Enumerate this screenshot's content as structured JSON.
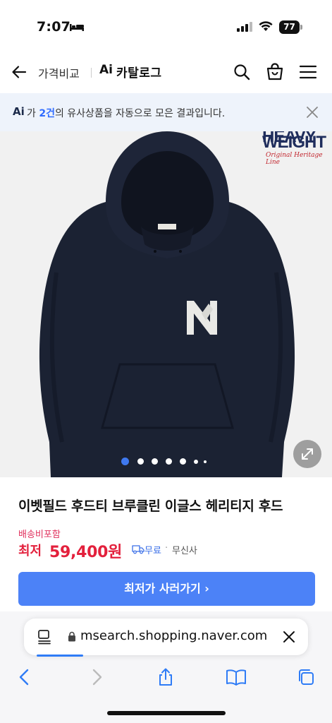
{
  "status_bar": {
    "time": "7:07",
    "battery": "77"
  },
  "header": {
    "price_compare": "가격비교",
    "ai": "Ai",
    "catalog": "카탈로그"
  },
  "banner": {
    "ai": "Ai",
    "prefix": "가 ",
    "count": "2건",
    "suffix": "의 유사상품을 자동으로 모은 결과입니다."
  },
  "image": {
    "brand_line1": "HEAVY",
    "brand_line2": "WEIGHT",
    "brand_tagline": "Original Heritage Line",
    "chest_logo": "NY",
    "carousel_count": 7,
    "carousel_active": 1
  },
  "product": {
    "title": "이벳필드 후드티 브루클린 이글스 헤리티지 후드",
    "shipping_tag": "배송비포함",
    "price_label": "최저",
    "price_value": "59,400원",
    "free_shipping": "무료",
    "separator": "·",
    "store": "무신사",
    "cta": "최저가 사러가기 ›"
  },
  "browser": {
    "url": "msearch.shopping.naver.com"
  },
  "colors": {
    "accent_blue": "#4c82f7",
    "price_red": "#e3203c",
    "hoodie_navy": "#1b2233"
  }
}
